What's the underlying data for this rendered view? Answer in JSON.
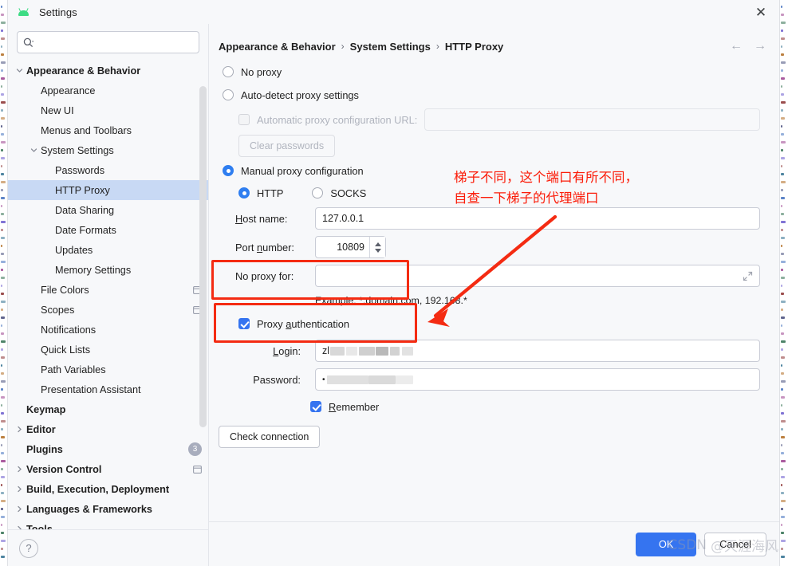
{
  "window": {
    "title": "Settings",
    "app_icon": "android-icon",
    "close_label": "✕"
  },
  "search": {
    "value": "",
    "placeholder": "",
    "icon": "search-icon"
  },
  "sidebar": {
    "items": [
      {
        "label": "Appearance & Behavior",
        "indent": 0,
        "bold": true,
        "arrow": "down",
        "selected": false
      },
      {
        "label": "Appearance",
        "indent": 1,
        "bold": false,
        "arrow": "none",
        "selected": false
      },
      {
        "label": "New UI",
        "indent": 1,
        "bold": false,
        "arrow": "none",
        "selected": false
      },
      {
        "label": "Menus and Toolbars",
        "indent": 1,
        "bold": false,
        "arrow": "none",
        "selected": false
      },
      {
        "label": "System Settings",
        "indent": 1,
        "bold": false,
        "arrow": "down",
        "selected": false
      },
      {
        "label": "Passwords",
        "indent": 2,
        "bold": false,
        "arrow": "none",
        "selected": false
      },
      {
        "label": "HTTP Proxy",
        "indent": 2,
        "bold": false,
        "arrow": "none",
        "selected": true
      },
      {
        "label": "Data Sharing",
        "indent": 2,
        "bold": false,
        "arrow": "none",
        "selected": false
      },
      {
        "label": "Date Formats",
        "indent": 2,
        "bold": false,
        "arrow": "none",
        "selected": false
      },
      {
        "label": "Updates",
        "indent": 2,
        "bold": false,
        "arrow": "none",
        "selected": false
      },
      {
        "label": "Memory Settings",
        "indent": 2,
        "bold": false,
        "arrow": "none",
        "selected": false
      },
      {
        "label": "File Colors",
        "indent": 1,
        "bold": false,
        "arrow": "none",
        "selected": false,
        "glyph": "project-scope-icon"
      },
      {
        "label": "Scopes",
        "indent": 1,
        "bold": false,
        "arrow": "none",
        "selected": false,
        "glyph": "project-scope-icon"
      },
      {
        "label": "Notifications",
        "indent": 1,
        "bold": false,
        "arrow": "none",
        "selected": false
      },
      {
        "label": "Quick Lists",
        "indent": 1,
        "bold": false,
        "arrow": "none",
        "selected": false
      },
      {
        "label": "Path Variables",
        "indent": 1,
        "bold": false,
        "arrow": "none",
        "selected": false
      },
      {
        "label": "Presentation Assistant",
        "indent": 1,
        "bold": false,
        "arrow": "none",
        "selected": false
      },
      {
        "label": "Keymap",
        "indent": 0,
        "bold": true,
        "arrow": "none",
        "selected": false
      },
      {
        "label": "Editor",
        "indent": 0,
        "bold": true,
        "arrow": "right",
        "selected": false
      },
      {
        "label": "Plugins",
        "indent": 0,
        "bold": true,
        "arrow": "none",
        "selected": false,
        "badge": "3"
      },
      {
        "label": "Version Control",
        "indent": 0,
        "bold": true,
        "arrow": "right",
        "selected": false,
        "glyph": "project-scope-icon"
      },
      {
        "label": "Build, Execution, Deployment",
        "indent": 0,
        "bold": true,
        "arrow": "right",
        "selected": false
      },
      {
        "label": "Languages & Frameworks",
        "indent": 0,
        "bold": true,
        "arrow": "right",
        "selected": false
      },
      {
        "label": "Tools",
        "indent": 0,
        "bold": true,
        "arrow": "right",
        "selected": false
      }
    ],
    "help_label": "?"
  },
  "breadcrumb": {
    "parts": [
      "Appearance & Behavior",
      "System Settings",
      "HTTP Proxy"
    ],
    "separator": "›",
    "back_icon": "arrow-left-icon",
    "forward_icon": "arrow-right-icon"
  },
  "proxy": {
    "no_proxy_label": "No proxy",
    "no_proxy_selected": false,
    "auto_detect_label": "Auto-detect proxy settings",
    "auto_detect_selected": false,
    "auto_config_url_label": "Automatic proxy configuration URL:",
    "auto_config_url_value": "",
    "auto_config_url_enabled": false,
    "clear_passwords_label": "Clear passwords",
    "clear_passwords_enabled": false,
    "manual_label": "Manual proxy configuration",
    "manual_selected": true,
    "http_label": "HTTP",
    "http_selected": true,
    "socks_label": "SOCKS",
    "socks_selected": false,
    "host_label": "Host name:",
    "host_mnemonic": "H",
    "host_value": "127.0.0.1",
    "port_label": "Port number:",
    "port_mnemonic": "n",
    "port_value": "10809",
    "no_proxy_for_label": "No proxy for:",
    "no_proxy_for_value": "",
    "example_hint": "Example: *.domain.com, 192.168.*",
    "auth_label": "Proxy authentication",
    "auth_mnemonic": "a",
    "auth_checked": true,
    "login_label": "Login:",
    "login_mnemonic": "L",
    "login_value": "zl",
    "login_redacted": true,
    "password_label": "Password:",
    "password_value": "•",
    "password_redacted": true,
    "remember_label": "Remember",
    "remember_mnemonic": "R",
    "remember_checked": true,
    "check_connection_label": "Check connection"
  },
  "footer": {
    "ok_label": "OK",
    "cancel_label": "Cancel"
  },
  "annotations": {
    "note_line1": "梯子不同，这个端口有所不同，",
    "note_line2": "自查一下梯子的代理端口",
    "color": "#fb1c09"
  },
  "watermark": {
    "brand": "CSDN",
    "author": "@天涯海风"
  },
  "colors": {
    "accent": "#3574f0",
    "radio_on": "#2f7ef0",
    "selection": "#c8d9f4",
    "annotation_red": "#f42b12",
    "panel_bg": "#f7f8fa",
    "badge_grey": "#a8adbd"
  }
}
